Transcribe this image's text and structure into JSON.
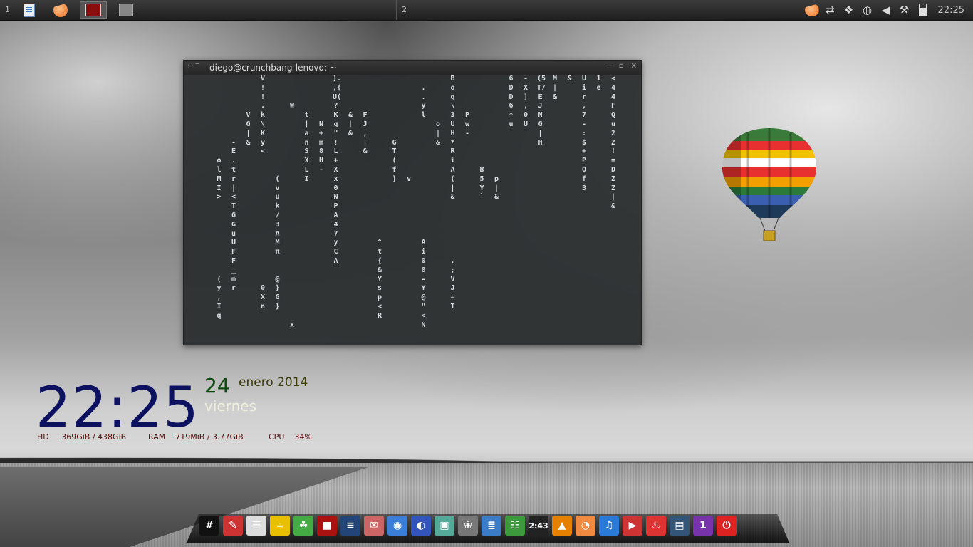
{
  "top_panel": {
    "workspaces": [
      "1",
      "2"
    ],
    "clock": "22:25",
    "tray_icons": [
      "crunchbang-icon",
      "network-sync-icon",
      "dropbox-icon",
      "wifi-icon",
      "volume-icon",
      "tools-icon",
      "battery-icon"
    ],
    "tasks": [
      "document-icon",
      "crunchbang-icon",
      "terminal-icon",
      "home-icon"
    ]
  },
  "terminal": {
    "title": "diego@crunchbang-lenovo: ~",
    "columns": [
      "",
      "\n\n\n\n\n\n\n\n\n\n\n\n\n\n\n\n\n\n\n\n\n\n\n\n\n",
      "\n\n\n\n\n\n\n\n\no\nl\nM\nI\n>\n\n\n\n\n\n\n\n\n(\ny\n,\nI\nq",
      "\n\n\n\n\n\n\n-\nE\n.\nt\nr\n|\n<\nT\nG\nG\nu\nU\nF\nF\n_\nm\nr",
      "\n\n\n\nV\nG\n|\n&\n",
      "V\n!\n!\n.\nk\n\\\nK\ny\n<\n\n\n\n\n\n\n\n\n\n\n\n\n\n\n0\nX\nn",
      "\n\n\n\n\n\n\n\n\n\n\n(\nv\nu\nk\n/\n3\nA\nM\nπ\n\n\n@\n}\nG\n}",
      "\n\n\nW\n\n\n\n\n\n\n\n\n\n\n\n\n\n\n\n\n\n\n\n\n\n\n\nx",
      "\n\n\n\nt\n|\na\nn\nS\nX\nL\nI",
      "\n\n\n\n\nN\n+\nm\n8\nH\n-",
      ").\n,{\nU(\n?\nK\nq\n\"\n!\nL\n+\nX\nx\n0\nN\nP\nA\n4\n7\ny\nC\nA",
      "\n\n\n\n&\n|\n&",
      "\n\n\n\nF\nJ\n,\n|\n&",
      "\n\n\n\n\n\n\n\n\n\n\n\n\n\n\n\n\n\n^\nt\n{\n&\nY\ns\np\n<\nR",
      "\n\n\n\n\n\n\nG\nT\n(\nf\n]",
      "\n\n\n\n\n\n\n\n\n\n\nv",
      "\n.\n.\ny\nl\n\n\n\n\n\n\n\n\n\n\n\n\n\nA\ni\n0\n0\n-\nY\n@\n\"\n<\nN",
      "\n\n\n\n\no\n|\n&",
      "B\no\nq\n\\\n3\nU\nH\n*\nR\ni\nA\n(\n|\n&\n\n\n\n\n\n\n.\n;\nV\nJ\n=\nT",
      "\n\n\n\nP\nw\n-",
      "\n\n\n\n\n\n\n\n\n\nB\n5\nY\n`",
      "\n\n\n\n\n\n\n\n\n\n\np\n|\n&",
      "6\nD\nD\n6\n*\nu",
      "-\nX\n]\n,\n0\nU",
      "(5\nT/\nE\nJ\nN\nG\n|\nH",
      "M\n|\n&",
      "&\n\n\n\n\n\n\n\n\n\n\n\n\n\n\n\n\n\n\n\n\n\n\n\n\n\n",
      "U\ni\nr\n,\n7\n-\n:\n$\n+\nP\nO\nf\n3",
      "1\ne",
      "<\n4\n4\nF\nQ\nu\n2\nZ\n!\n=\nD\nZ\nZ\n|\n&"
    ]
  },
  "conky": {
    "time": "22:25",
    "day": "24",
    "month_year": "enero 2014",
    "weekday": "viernes",
    "hd_label": "HD",
    "hd_value": "369GiB  / 438GiB",
    "ram_label": "RAM",
    "ram_value": "719MiB  / 3.77GiB",
    "cpu_label": "CPU",
    "cpu_value": "34%"
  },
  "dock": {
    "items": [
      {
        "name": "crunchbang-terminal-icon",
        "glyph": "#",
        "color": "#111"
      },
      {
        "name": "text-editor-icon",
        "glyph": "✎",
        "color": "#c33"
      },
      {
        "name": "file-cabinet-icon",
        "glyph": "☰",
        "color": "#ddd"
      },
      {
        "name": "teapot-icon",
        "glyph": "☕",
        "color": "#e8c000"
      },
      {
        "name": "leaf-icon",
        "glyph": "☘",
        "color": "#4a4"
      },
      {
        "name": "terminal-icon",
        "glyph": "■",
        "color": "#a11"
      },
      {
        "name": "calculator-icon",
        "glyph": "≡",
        "color": "#247"
      },
      {
        "name": "package-icon",
        "glyph": "✉",
        "color": "#c66"
      },
      {
        "name": "chromium-icon",
        "glyph": "◉",
        "color": "#3a7ed8"
      },
      {
        "name": "globe-icon",
        "glyph": "◐",
        "color": "#3355bb"
      },
      {
        "name": "image-viewer-icon",
        "glyph": "▣",
        "color": "#5a9"
      },
      {
        "name": "gimp-icon",
        "glyph": "❀",
        "color": "#777"
      },
      {
        "name": "document-icon",
        "glyph": "≣",
        "color": "#3b7cc9"
      },
      {
        "name": "spreadsheet-icon",
        "glyph": "☷",
        "color": "#3c9a3c"
      },
      {
        "name": "timer-icon",
        "glyph": "2:43",
        "color": "#222"
      },
      {
        "name": "vlc-icon",
        "glyph": "▲",
        "color": "#e68000"
      },
      {
        "name": "crunchbang-icon",
        "glyph": "◔",
        "color": "#f08a40"
      },
      {
        "name": "music-icon",
        "glyph": "♫",
        "color": "#2a7ad8"
      },
      {
        "name": "media-player-icon",
        "glyph": "▶",
        "color": "#c33"
      },
      {
        "name": "fire-icon",
        "glyph": "♨",
        "color": "#d33"
      },
      {
        "name": "window-icon",
        "glyph": "▤",
        "color": "#357"
      },
      {
        "name": "workspace-switcher-icon",
        "glyph": "1",
        "color": "#73a"
      },
      {
        "name": "power-icon",
        "glyph": "⏻",
        "color": "#d22"
      }
    ]
  },
  "colors": {
    "conky_time": "#0c1160",
    "conky_day": "#0e4a0e",
    "conky_stats": "#5a0a0a"
  }
}
